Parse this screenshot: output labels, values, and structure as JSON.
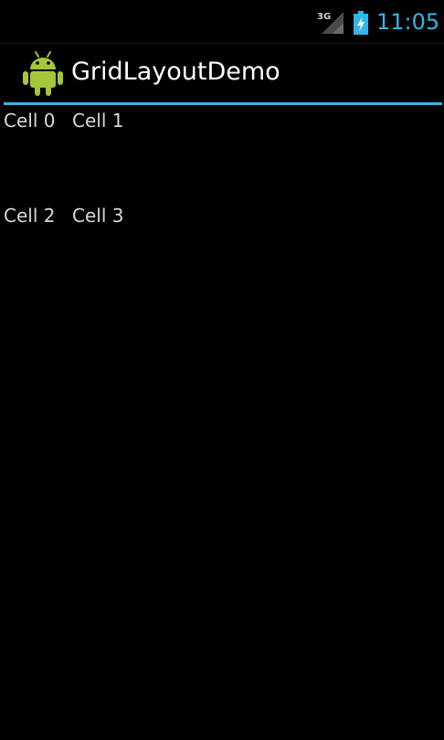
{
  "status_bar": {
    "network_type": "3G",
    "time": "11:05",
    "signal_icon": "signal-icon",
    "battery_icon": "battery-charging-icon",
    "accent_color": "#33b5e5"
  },
  "action_bar": {
    "app_icon": "android-robot-icon",
    "title": "GridLayoutDemo"
  },
  "grid": {
    "cells": [
      "Cell 0",
      "Cell 1",
      "Cell 2",
      "Cell 3"
    ]
  }
}
